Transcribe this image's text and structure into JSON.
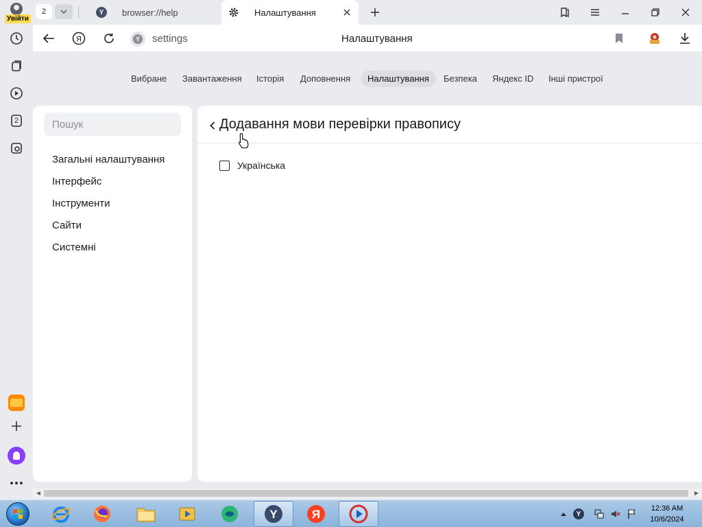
{
  "sidebar": {
    "login_label": "Увійти",
    "tab_group_badge": "2"
  },
  "tabs": {
    "count": "2",
    "items": [
      {
        "title": "browser://help"
      },
      {
        "title": "Налаштування"
      }
    ]
  },
  "address_bar": {
    "url": "settings",
    "page_title": "Налаштування"
  },
  "settings_nav": {
    "items": [
      "Вибране",
      "Завантаження",
      "Історія",
      "Доповнення",
      "Налаштування",
      "Безпека",
      "Яндекс ID",
      "Інші пристрої"
    ],
    "active": "Налаштування"
  },
  "left_panel": {
    "search_placeholder": "Пошук",
    "menu": [
      "Загальні налаштування",
      "Інтерфейс",
      "Інструменти",
      "Сайти",
      "Системні"
    ]
  },
  "main": {
    "title": "Додавання мови перевірки правопису",
    "languages": [
      {
        "label": "Українська",
        "checked": false
      }
    ]
  },
  "taskbar": {
    "time": "12:36 AM",
    "date": "10/6/2024"
  },
  "colors": {
    "accent_yellow": "#ffdb4d",
    "alice_purple": "#8a3ffc",
    "yandex_red": "#fc3f1d"
  }
}
